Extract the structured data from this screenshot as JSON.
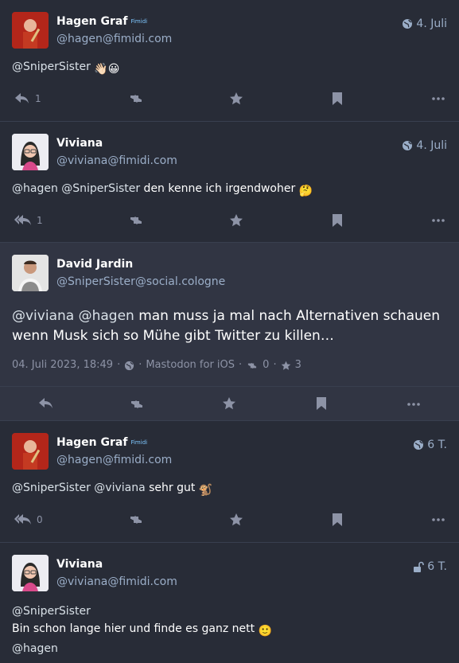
{
  "statuses": [
    {
      "name": "Hagen Graf",
      "bot_label": "Fimidi",
      "acct": "@hagen@fimidi.com",
      "time": "4. Juli",
      "visibility": "globe-icon",
      "text": "@SniperSister",
      "emoji": "👋🏻😀",
      "replies": "1"
    },
    {
      "name": "Viviana",
      "acct": "@viviana@fimidi.com",
      "time": "4. Juli",
      "visibility": "globe-icon",
      "text_mentions": "@hagen @SniperSister",
      "text_rest": " den kenne ich irgendwoher",
      "emoji": "🤔",
      "replies": "1"
    },
    {
      "name": "David Jardin",
      "acct": "@SniperSister@social.cologne",
      "text_mentions": "@viviana @hagen",
      "text_rest": " man muss ja mal nach Alternativen schauen wenn Musk sich so Mühe gibt Twitter zu killen…",
      "meta_date": "04. Juli 2023, 18:49",
      "meta_sep": "·",
      "meta_app": "Mastodon for iOS",
      "meta_reblogs": "0",
      "meta_favs": "3"
    },
    {
      "name": "Hagen Graf",
      "bot_label": "Fimidi",
      "acct": "@hagen@fimidi.com",
      "time": "6 T.",
      "visibility": "globe-icon",
      "text_mentions": "@SniperSister @viviana",
      "text_rest": " sehr gut",
      "emoji": "🐒",
      "replies": "0"
    },
    {
      "name": "Viviana",
      "acct": "@viviana@fimidi.com",
      "time": "6 T.",
      "visibility": "unlock-icon",
      "line1": "@SniperSister",
      "line2": "Bin schon lange hier und finde es ganz nett",
      "emoji": "🙂",
      "line3": "@hagen"
    }
  ]
}
